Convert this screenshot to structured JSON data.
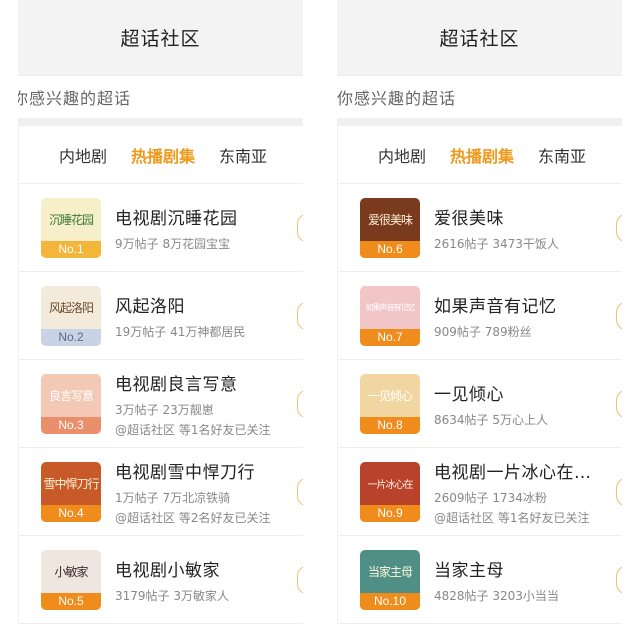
{
  "panels": [
    {
      "header_title": "超话社区",
      "subtitle": "你感兴趣的超话",
      "tabs": [
        "内地剧",
        "热播剧集",
        "东南亚"
      ],
      "items": [
        {
          "art": "沉睡花园",
          "rank": "No.1",
          "name": "电视剧沉睡花园",
          "stats": "9万帖子  8万花园宝宝",
          "social": ""
        },
        {
          "art": "风起洛阳",
          "rank": "No.2",
          "name": "风起洛阳",
          "stats": "19万帖子  41万神都居民",
          "social": ""
        },
        {
          "art": "良言写意",
          "rank": "No.3",
          "name": "电视剧良言写意",
          "stats": "3万帖子  23万靓崽",
          "social": "@超话社区 等1名好友已关注"
        },
        {
          "art": "雪中悍刀行",
          "rank": "No.4",
          "name": "电视剧雪中悍刀行",
          "stats": "1万帖子  7万北凉铁骑",
          "social": "@超话社区 等2名好友已关注"
        },
        {
          "art": "小敏家",
          "rank": "No.5",
          "name": "电视剧小敏家",
          "stats": "3179帖子  3万敏家人",
          "social": ""
        }
      ]
    },
    {
      "header_title": "超话社区",
      "subtitle": "你感兴趣的超话",
      "tabs": [
        "内地剧",
        "热播剧集",
        "东南亚"
      ],
      "items": [
        {
          "art": "爱很美味",
          "rank": "No.6",
          "name": "爱很美味",
          "stats": "2616帖子  3473干饭人",
          "social": ""
        },
        {
          "art": "如果声音有记忆",
          "rank": "No.7",
          "name": "如果声音有记忆",
          "stats": "909帖子  789粉丝",
          "social": ""
        },
        {
          "art": "一见倾心",
          "rank": "No.8",
          "name": "一见倾心",
          "stats": "8634帖子  5万心上人",
          "social": ""
        },
        {
          "art": "一片冰心在",
          "rank": "No.9",
          "name": "电视剧一片冰心在…",
          "stats": "2609帖子  1734冰粉",
          "social": "@超话社区 等1名好友已关注"
        },
        {
          "art": "当家主母",
          "rank": "No.10",
          "name": "当家主母",
          "stats": "4828帖子  3203小当当",
          "social": ""
        }
      ]
    }
  ],
  "colors": {
    "accent": "#ef9a1c",
    "rank_badge": "#ef8c1c",
    "thumb_bg": [
      "#f6efc9",
      "#f3eadb",
      "#f3c8b4",
      "#c85a2a",
      "#efe6e0",
      "#7a3a1e",
      "#f2c6c6",
      "#f1d6a2",
      "#b8432a",
      "#4f8f86"
    ]
  }
}
